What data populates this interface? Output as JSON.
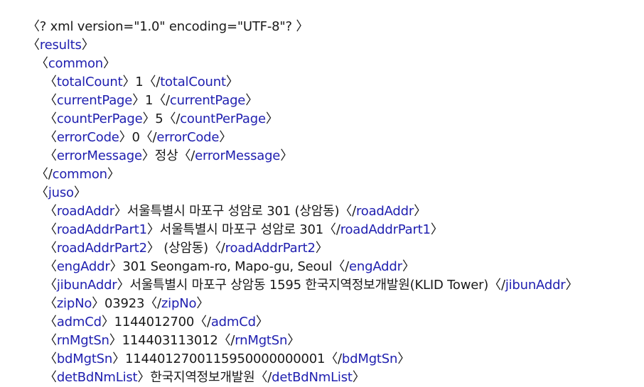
{
  "lines": [
    {
      "level": 0,
      "kind": "decl",
      "text": "〈? xml version=\"1.0\" encoding=\"UTF-8\"? 〉"
    },
    {
      "level": 0,
      "kind": "open",
      "tag": "results"
    },
    {
      "level": 1,
      "kind": "open",
      "tag": "common"
    },
    {
      "level": 2,
      "kind": "el",
      "tag": "totalCount",
      "value": "1"
    },
    {
      "level": 2,
      "kind": "el",
      "tag": "currentPage",
      "value": "1"
    },
    {
      "level": 2,
      "kind": "el",
      "tag": "countPerPage",
      "value": "5"
    },
    {
      "level": 2,
      "kind": "el",
      "tag": "errorCode",
      "value": "0"
    },
    {
      "level": 2,
      "kind": "el",
      "tag": "errorMessage",
      "value": "정상"
    },
    {
      "level": 1,
      "kind": "close",
      "tag": "common"
    },
    {
      "level": 1,
      "kind": "open",
      "tag": "juso"
    },
    {
      "level": 2,
      "kind": "el",
      "tag": "roadAddr",
      "value": "서울특별시 마포구 성암로 301 (상암동)"
    },
    {
      "level": 2,
      "kind": "el",
      "tag": "roadAddrPart1",
      "value": "서울특별시 마포구 성암로 301"
    },
    {
      "level": 2,
      "kind": "el",
      "tag": "roadAddrPart2",
      "value": " (상암동)"
    },
    {
      "level": 2,
      "kind": "el",
      "tag": "engAddr",
      "value": "301 Seongam-ro, Mapo-gu, Seoul"
    },
    {
      "level": 2,
      "kind": "el",
      "tag": "jibunAddr",
      "value": "서울특별시 마포구 상암동 1595 한국지역정보개발원(KLID Tower)"
    },
    {
      "level": 2,
      "kind": "el",
      "tag": "zipNo",
      "value": "03923"
    },
    {
      "level": 2,
      "kind": "el",
      "tag": "admCd",
      "value": "1144012700"
    },
    {
      "level": 2,
      "kind": "el",
      "tag": "rnMgtSn",
      "value": "114403113012"
    },
    {
      "level": 2,
      "kind": "el",
      "tag": "bdMgtSn",
      "value": "1144012700115950000000001"
    },
    {
      "level": 2,
      "kind": "el",
      "tag": "detBdNmList",
      "value": "한국지역정보개발원"
    }
  ]
}
